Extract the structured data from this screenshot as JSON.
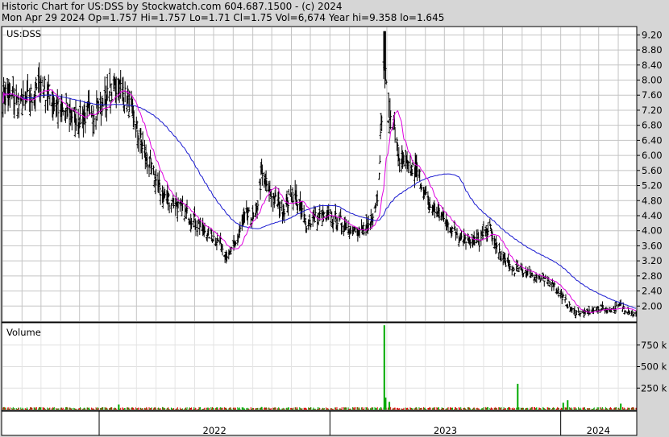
{
  "header": {
    "line1": "Historic Chart for US:DSS by Stockwatch.com 604.687.1500 - (c) 2024",
    "line2": "Mon Apr 29 2024   Op=1.757  Hi=1.757  Lo=1.71  Cl=1.75  Vol=6,674  Year hi=9.358  lo=1.645"
  },
  "colors": {
    "background": "#d6d6d6",
    "plot": "#ffffff",
    "price_bars": "#000000",
    "ma_short": "#e000e0",
    "ma_long": "#1a1ad0",
    "volume_up": "#00aa00",
    "volume_down": "#dd0000"
  },
  "chart_data": [
    {
      "type": "ohlc",
      "panel_label": "US:DSS",
      "ylim": [
        1.6,
        9.4
      ],
      "yticks": [
        9.2,
        8.8,
        8.4,
        8.0,
        7.6,
        7.2,
        6.8,
        6.4,
        6.0,
        5.6,
        5.2,
        4.8,
        4.4,
        4.0,
        3.6,
        3.2,
        2.8,
        2.4,
        2.0
      ],
      "ytick_labels": [
        "9.20",
        "8.80",
        "8.40",
        "8.00",
        "7.60",
        "7.20",
        "6.80",
        "6.40",
        "6.00",
        "5.60",
        "5.20",
        "4.80",
        "4.40",
        "4.00",
        "3.60",
        "3.20",
        "2.80",
        "2.40",
        "2.00"
      ],
      "x_period": [
        "2021-08",
        "2024-04-29"
      ],
      "price_profile": [
        [
          "2021-08-02",
          7.7
        ],
        [
          "2021-09-01",
          7.3
        ],
        [
          "2021-10-01",
          7.9
        ],
        [
          "2021-11-01",
          7.2
        ],
        [
          "2021-12-01",
          7.0
        ],
        [
          "2022-01-03",
          7.3
        ],
        [
          "2022-02-01",
          7.9
        ],
        [
          "2022-02-20",
          7.2
        ],
        [
          "2022-03-15",
          6.0
        ],
        [
          "2022-04-10",
          5.0
        ],
        [
          "2022-05-10",
          4.6
        ],
        [
          "2022-06-10",
          4.1
        ],
        [
          "2022-07-10",
          3.7
        ],
        [
          "2022-07-25",
          3.3
        ],
        [
          "2022-08-10",
          3.9
        ],
        [
          "2022-08-20",
          4.4
        ],
        [
          "2022-09-05",
          4.3
        ],
        [
          "2022-09-15",
          5.5
        ],
        [
          "2022-10-01",
          4.9
        ],
        [
          "2022-10-20",
          4.6
        ],
        [
          "2022-11-05",
          5.0
        ],
        [
          "2022-11-25",
          4.2
        ],
        [
          "2022-12-15",
          4.4
        ],
        [
          "2023-01-10",
          4.3
        ],
        [
          "2023-02-01",
          4.1
        ],
        [
          "2023-02-15",
          3.9
        ],
        [
          "2023-03-05",
          4.2
        ],
        [
          "2023-03-18",
          5.0
        ],
        [
          "2023-03-28",
          8.6
        ],
        [
          "2023-04-02",
          7.2
        ],
        [
          "2023-04-10",
          7.0
        ],
        [
          "2023-04-20",
          5.9
        ],
        [
          "2023-05-05",
          5.6
        ],
        [
          "2023-05-20",
          5.6
        ],
        [
          "2023-06-05",
          4.7
        ],
        [
          "2023-06-25",
          4.4
        ],
        [
          "2023-07-15",
          4.0
        ],
        [
          "2023-08-05",
          3.8
        ],
        [
          "2023-08-25",
          3.7
        ],
        [
          "2023-09-10",
          4.1
        ],
        [
          "2023-09-25",
          3.4
        ],
        [
          "2023-10-15",
          3.0
        ],
        [
          "2023-11-10",
          2.9
        ],
        [
          "2023-12-01",
          2.7
        ],
        [
          "2023-12-20",
          2.6
        ],
        [
          "2024-01-01",
          2.3
        ],
        [
          "2024-01-20",
          1.85
        ],
        [
          "2024-02-10",
          1.8
        ],
        [
          "2024-03-01",
          1.95
        ],
        [
          "2024-03-20",
          1.9
        ],
        [
          "2024-04-05",
          2.0
        ],
        [
          "2024-04-29",
          1.75
        ]
      ],
      "series": [
        {
          "name": "",
          "role": "price",
          "color": "#000000"
        },
        {
          "name": "",
          "role": "short moving average",
          "color": "#e000e0"
        },
        {
          "name": "",
          "role": "long moving average",
          "color": "#1a1ad0"
        }
      ],
      "year_hi": 9.358,
      "year_lo": 1.645
    },
    {
      "type": "bar",
      "panel_label": "Volume",
      "ylim": [
        0,
        1000000
      ],
      "yticks": [
        750000,
        500000,
        250000
      ],
      "ytick_labels": [
        "750 k",
        "500 k",
        "250 k"
      ],
      "volume_spikes": [
        [
          "2022-02-01",
          60000
        ],
        [
          "2022-09-15",
          30000
        ],
        [
          "2023-03-28",
          980000
        ],
        [
          "2023-03-30",
          140000
        ],
        [
          "2023-04-05",
          90000
        ],
        [
          "2023-10-25",
          300000
        ],
        [
          "2024-01-05",
          80000
        ],
        [
          "2024-01-12",
          110000
        ],
        [
          "2024-04-05",
          70000
        ]
      ]
    }
  ],
  "xaxis": {
    "years": [
      {
        "label": "2022",
        "start": "2022-01-01"
      },
      {
        "label": "2023",
        "start": "2023-01-01"
      },
      {
        "label": "2024",
        "start": "2024-01-01"
      }
    ]
  }
}
